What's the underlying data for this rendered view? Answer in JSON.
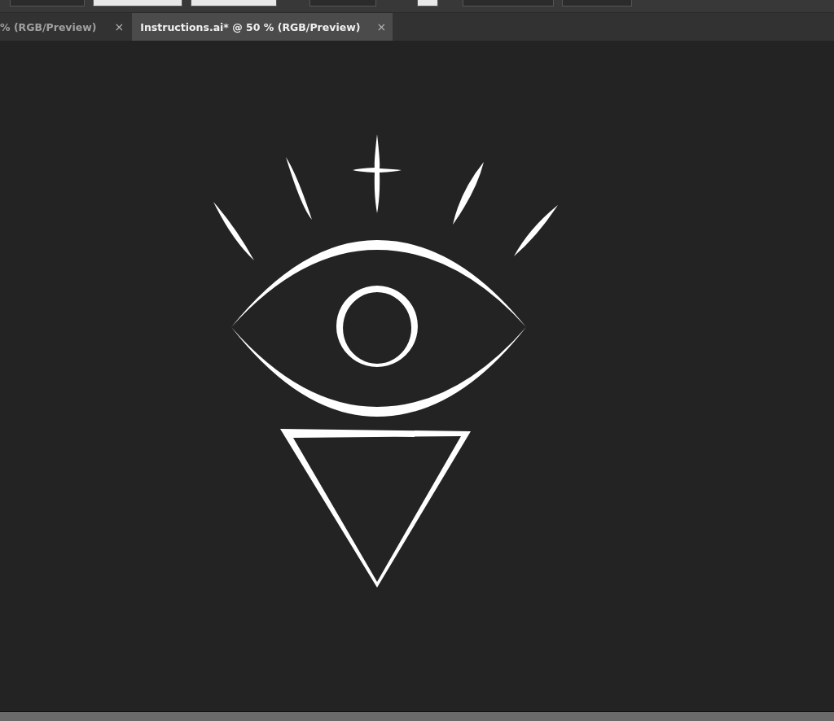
{
  "tabs": [
    {
      "label": "% (RGB/Preview)",
      "close": "×",
      "selected": false
    },
    {
      "label": "Instructions.ai* @ 50 % (RGB/Preview)",
      "close": "×",
      "selected": true
    }
  ]
}
